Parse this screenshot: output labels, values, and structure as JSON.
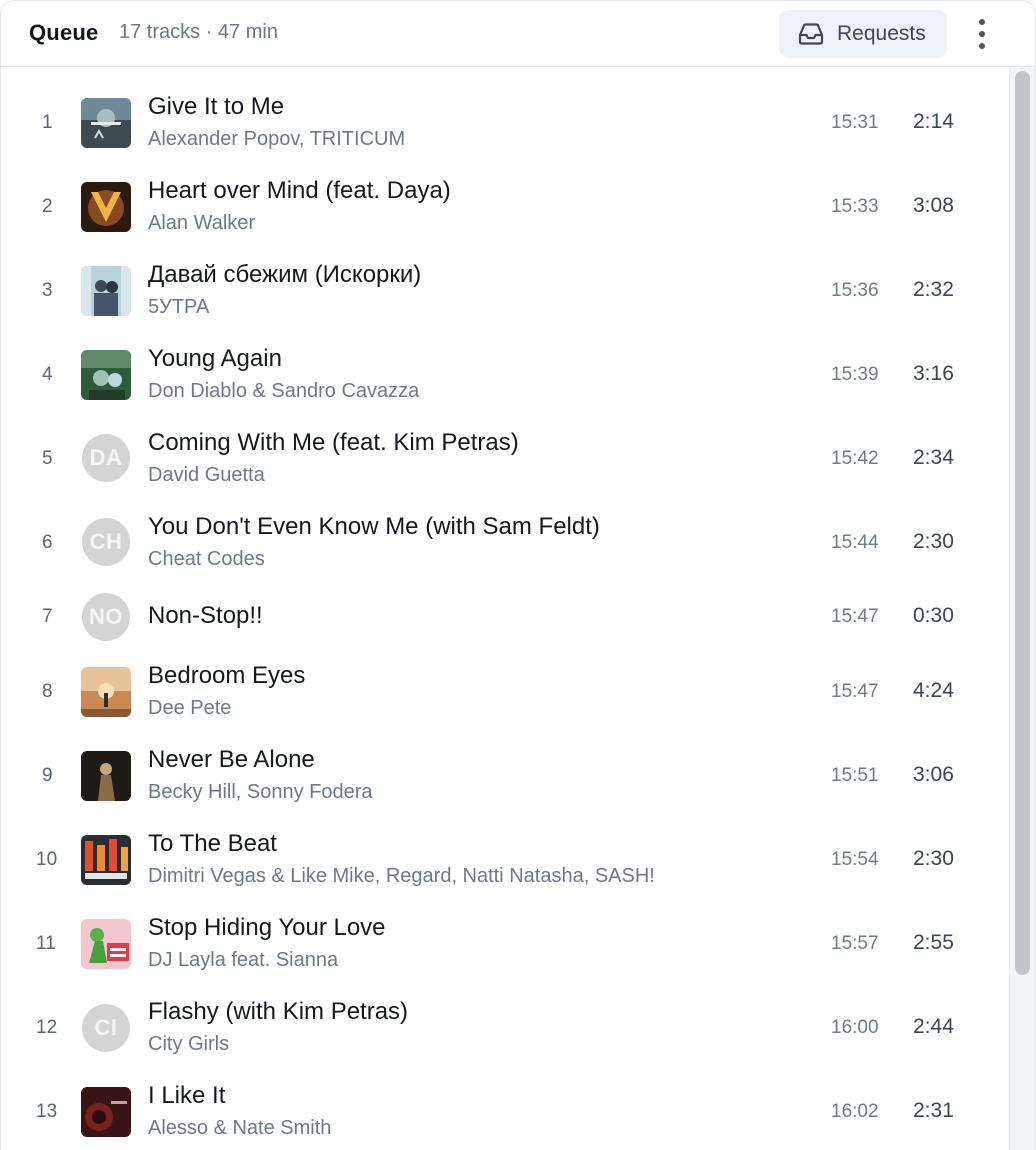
{
  "header": {
    "title": "Queue",
    "meta": "17 tracks · 47 min",
    "requests_label": "Requests"
  },
  "tracks": [
    {
      "num": "1",
      "title": "Give It to Me",
      "artist": "Alexander Popov, TRITICUM",
      "time": "15:31",
      "duration": "2:14",
      "art": "cover"
    },
    {
      "num": "2",
      "title": "Heart over Mind (feat. Daya)",
      "artist": "Alan Walker",
      "time": "15:33",
      "duration": "3:08",
      "art": "cover"
    },
    {
      "num": "3",
      "title": "Давай сбежим (Искорки)",
      "artist": "5УТРА",
      "time": "15:36",
      "duration": "2:32",
      "art": "cover"
    },
    {
      "num": "4",
      "title": "Young Again",
      "artist": "Don Diablo & Sandro Cavazza",
      "time": "15:39",
      "duration": "3:16",
      "art": "cover"
    },
    {
      "num": "5",
      "title": "Coming With Me (feat. Kim Petras)",
      "artist": "David Guetta",
      "time": "15:42",
      "duration": "2:34",
      "art": "initials",
      "initials": "DA"
    },
    {
      "num": "6",
      "title": "You Don't Even Know Me (with Sam Feldt)",
      "artist": "Cheat Codes",
      "time": "15:44",
      "duration": "2:30",
      "art": "initials",
      "initials": "CH"
    },
    {
      "num": "7",
      "title": "Non-Stop!!",
      "artist": "",
      "time": "15:47",
      "duration": "0:30",
      "art": "initials",
      "initials": "NO"
    },
    {
      "num": "8",
      "title": "Bedroom Eyes",
      "artist": "Dee Pete",
      "time": "15:47",
      "duration": "4:24",
      "art": "cover"
    },
    {
      "num": "9",
      "title": "Never Be Alone",
      "artist": "Becky Hill, Sonny Fodera",
      "time": "15:51",
      "duration": "3:06",
      "art": "cover"
    },
    {
      "num": "10",
      "title": "To The Beat",
      "artist": "Dimitri Vegas & Like Mike, Regard, Natti Natasha, SASH!",
      "time": "15:54",
      "duration": "2:30",
      "art": "cover"
    },
    {
      "num": "11",
      "title": "Stop Hiding Your Love",
      "artist": "DJ Layla feat. Sianna",
      "time": "15:57",
      "duration": "2:55",
      "art": "cover"
    },
    {
      "num": "12",
      "title": "Flashy (with Kim Petras)",
      "artist": "City Girls",
      "time": "16:00",
      "duration": "2:44",
      "art": "initials",
      "initials": "CI"
    },
    {
      "num": "13",
      "title": "I Like It",
      "artist": "Alesso & Nate Smith",
      "time": "16:02",
      "duration": "2:31",
      "art": "cover"
    }
  ]
}
